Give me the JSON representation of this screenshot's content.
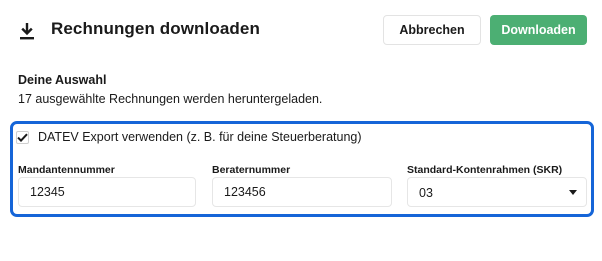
{
  "header": {
    "icon": "download-icon",
    "title": "Rechnungen downloaden",
    "cancel_label": "Abbrechen",
    "download_label": "Downloaden"
  },
  "selection": {
    "heading": "Deine Auswahl",
    "text": "17 ausgewählte Rechnungen werden heruntergeladen."
  },
  "datev": {
    "checked": true,
    "checkbox_label": "DATEV Export verwenden (z. B. für deine Steuerberatung)",
    "fields": [
      {
        "label": "Mandantennummer",
        "value": "12345"
      },
      {
        "label": "Beraternummer",
        "value": "123456"
      }
    ],
    "skr": {
      "label": "Standard-Kontenrahmen (SKR)",
      "value": "03"
    }
  },
  "colors": {
    "accent": "#1565d8",
    "primary_button": "#4caf73"
  }
}
